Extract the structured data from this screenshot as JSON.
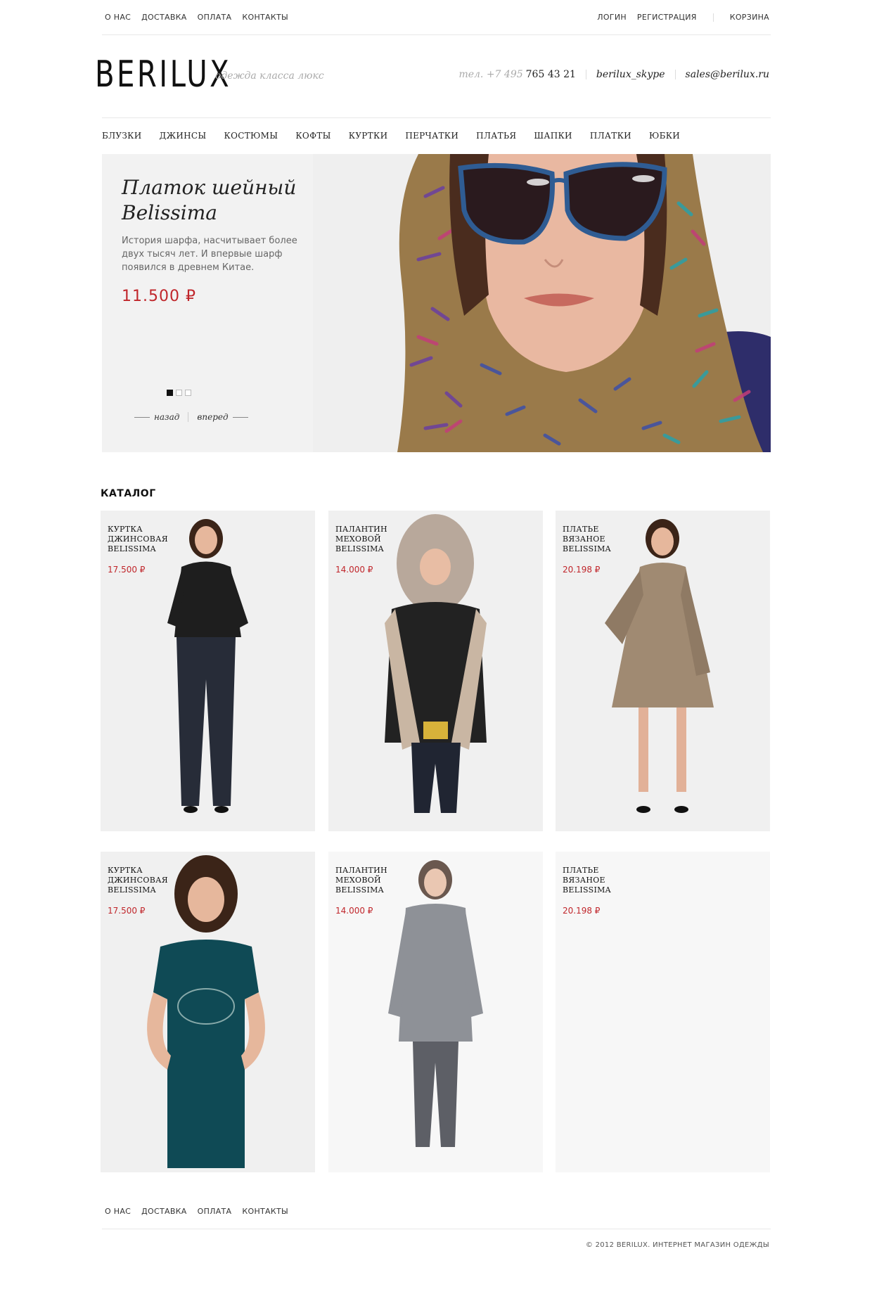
{
  "top_nav": {
    "items": [
      "О НАС",
      "ДОСТАВКА",
      "ОПЛАТА",
      "КОНТАКТЫ"
    ]
  },
  "account": {
    "login": "ЛОГИН",
    "register": "РЕГИСТРАЦИЯ",
    "cart": "КОРЗИНА"
  },
  "brand": {
    "logo": "BERILUX",
    "tagline": "одежда класса люкс"
  },
  "contacts": {
    "phone_label": "тел. +7 495",
    "phone_number": "765 43 21",
    "skype": "berilux_skype",
    "email": "sales@berilux.ru"
  },
  "categories": [
    "БЛУЗКИ",
    "ДЖИНСЫ",
    "КОСТЮМЫ",
    "КОФТЫ",
    "КУРТКИ",
    "ПЕРЧАТКИ",
    "ПЛАТЬЯ",
    "ШАПКИ",
    "ПЛАТКИ",
    "ЮБКИ"
  ],
  "hero": {
    "title_line1": "Платок шейный",
    "title_line2": "Belissima",
    "description": "История шарфа, насчитывает более двух тысяч лет. И впервые шарф появился в древнем Китае.",
    "price": "11.500 ₽",
    "prev_label": "назад",
    "next_label": "вперед",
    "active_slide": 1,
    "slide_count": 3
  },
  "catalog": {
    "title": "КАТАЛОГ",
    "products": [
      {
        "name": [
          "КУРТКА",
          "ДЖИНСОВАЯ",
          "BELISSIMA"
        ],
        "price": "17.500 ₽"
      },
      {
        "name": [
          "ПАЛАНТИН",
          "МЕХОВОЙ",
          "BELISSIMA"
        ],
        "price": "14.000 ₽"
      },
      {
        "name": [
          "ПЛАТЬЕ",
          "ВЯЗАНОЕ",
          "BELISSIMA"
        ],
        "price": "20.198 ₽"
      },
      {
        "name": [
          "КУРТКА",
          "ДЖИНСОВАЯ",
          "BELISSIMA"
        ],
        "price": "17.500 ₽"
      },
      {
        "name": [
          "ПАЛАНТИН",
          "МЕХОВОЙ",
          "BELISSIMA"
        ],
        "price": "14.000 ₽"
      },
      {
        "name": [
          "ПЛАТЬЕ",
          "ВЯЗАНОЕ",
          "BELISSIMA"
        ],
        "price": "20.198 ₽"
      }
    ]
  },
  "footer": {
    "nav": [
      "О НАС",
      "ДОСТАВКА",
      "ОПЛАТА",
      "КОНТАКТЫ"
    ],
    "copyright": "© 2012 BERILUX. ИНТЕРНЕТ МАГАЗИН ОДЕЖДЫ"
  },
  "colors": {
    "price": "#c0262b",
    "text": "#222222",
    "muted": "#aaaaaa"
  }
}
